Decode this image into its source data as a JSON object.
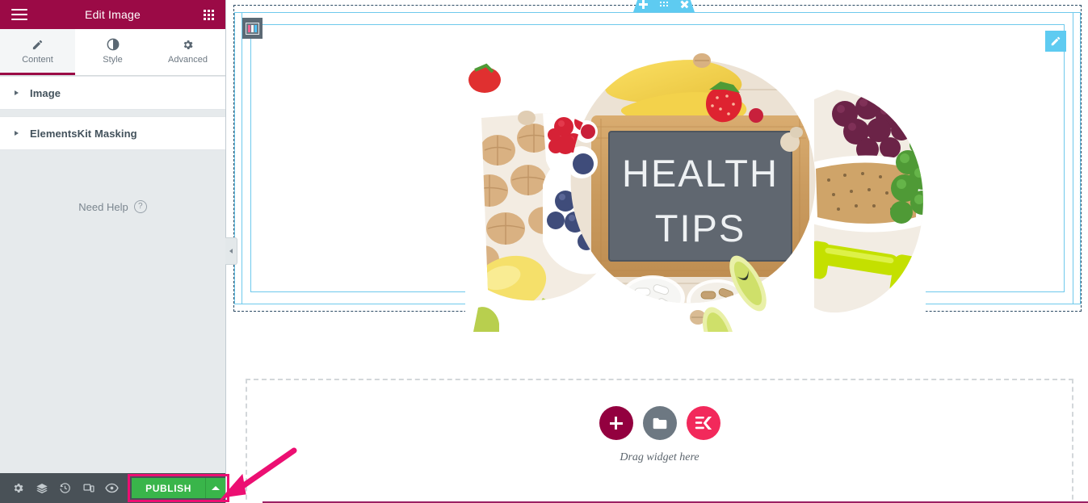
{
  "panel": {
    "header": {
      "title": "Edit Image",
      "menu_icon": "hamburger-icon",
      "widgets_icon": "grid-dots-icon"
    },
    "tabs": [
      {
        "label": "Content",
        "icon": "pencil-icon",
        "active": true
      },
      {
        "label": "Style",
        "icon": "contrast-icon",
        "active": false
      },
      {
        "label": "Advanced",
        "icon": "gear-icon",
        "active": false
      }
    ],
    "sections": [
      {
        "label": "Image",
        "expanded": false
      },
      {
        "label": "ElementsKit Masking",
        "expanded": false
      }
    ],
    "help": {
      "label": "Need Help",
      "icon": "question-circle-icon"
    },
    "footer": {
      "icons": [
        {
          "name": "settings-gear-icon",
          "title": "Settings"
        },
        {
          "name": "navigator-layers-icon",
          "title": "Navigator"
        },
        {
          "name": "history-clock-icon",
          "title": "History"
        },
        {
          "name": "responsive-mode-icon",
          "title": "Responsive Mode"
        },
        {
          "name": "preview-eye-icon",
          "title": "Preview Changes"
        }
      ],
      "publish_label": "PUBLISH",
      "publish_options_icon": "caret-up-icon"
    },
    "collapse_icon": "chevron-left-icon"
  },
  "canvas": {
    "section_toolbar": [
      {
        "name": "add-section-button",
        "icon": "plus-icon"
      },
      {
        "name": "edit-section-button",
        "icon": "dots-grid-icon"
      },
      {
        "name": "delete-section-button",
        "icon": "close-x-icon"
      }
    ],
    "column_handle_icon": "column-handle-icon",
    "widget_edit_icon": "pencil-edit-icon",
    "image": {
      "alt": "Health Tips chalkboard surrounded by healthy food",
      "board_line1": "HEALTH",
      "board_line2": "TIPS"
    },
    "drop_area": {
      "label": "Drag widget here",
      "buttons": [
        {
          "name": "add-new-widget-button",
          "icon": "plus-icon"
        },
        {
          "name": "add-template-button",
          "icon": "folder-icon"
        },
        {
          "name": "elementskit-button",
          "icon": "elementskit-logo-icon"
        }
      ]
    }
  },
  "annotation": {
    "arrow_color": "#ec0f72",
    "highlight_target": "PUBLISH"
  },
  "colors": {
    "panel_header": "#9b0a46",
    "panel_bg": "#e6eaec",
    "publish_green": "#39b54a",
    "highlight_pink": "#ec0f72",
    "section_blue": "#5ecbf1",
    "footer_dark": "#495157"
  }
}
